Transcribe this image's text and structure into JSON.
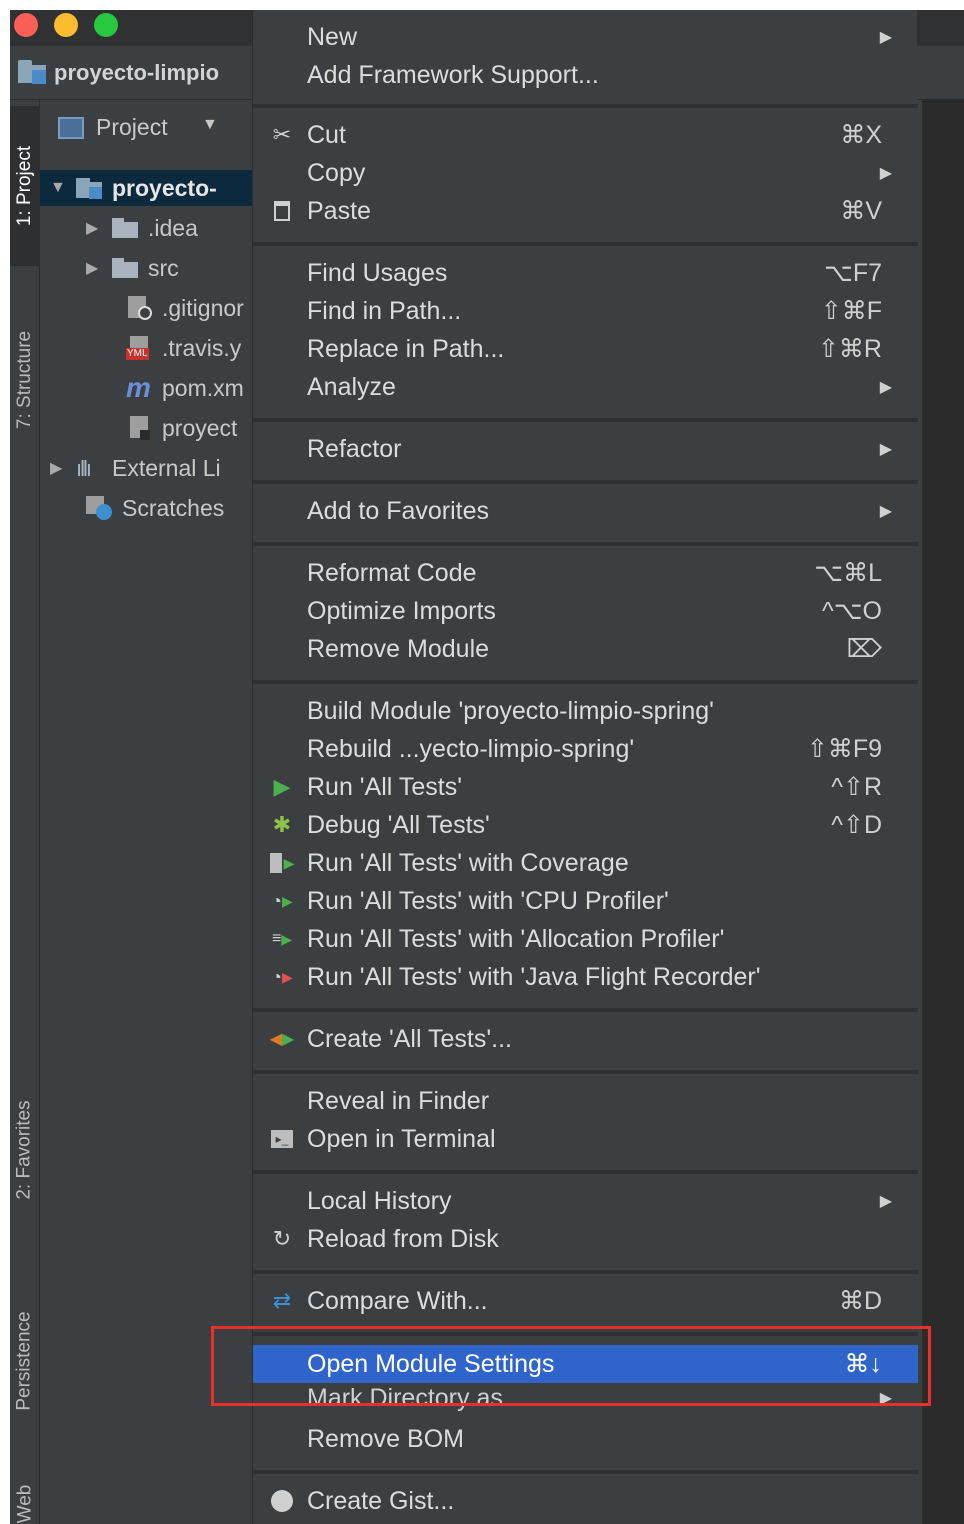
{
  "window": {
    "project_crumb": "proyecto-limpio"
  },
  "sidebar": {
    "tabs": [
      {
        "label": "1: Project"
      },
      {
        "label": "7: Structure"
      },
      {
        "label": "2: Favorites"
      },
      {
        "label": "Persistence"
      },
      {
        "label": "Web"
      }
    ]
  },
  "panel": {
    "header": "Project",
    "tree": [
      {
        "label": "proyecto-",
        "expanded": true
      },
      {
        "label": ".idea"
      },
      {
        "label": "src"
      },
      {
        "label": ".gitignor"
      },
      {
        "label": ".travis.y",
        "badge": "YML"
      },
      {
        "label": "pom.xm",
        "icon_glyph": "m"
      },
      {
        "label": "proyect"
      },
      {
        "label": "External Li"
      },
      {
        "label": "Scratches"
      }
    ]
  },
  "menu": {
    "items": [
      {
        "label": "New",
        "submenu": true
      },
      {
        "label": "Add Framework Support..."
      },
      {
        "label": "Cut",
        "shortcut": "⌘X",
        "icon": "scissors-icon"
      },
      {
        "label": "Copy",
        "submenu": true
      },
      {
        "label": "Paste",
        "shortcut": "⌘V",
        "icon": "clipboard-icon"
      },
      {
        "label": "Find Usages",
        "shortcut": "⌥F7"
      },
      {
        "label": "Find in Path...",
        "shortcut": "⇧⌘F"
      },
      {
        "label": "Replace in Path...",
        "shortcut": "⇧⌘R"
      },
      {
        "label": "Analyze",
        "submenu": true
      },
      {
        "label": "Refactor",
        "submenu": true
      },
      {
        "label": "Add to Favorites",
        "submenu": true
      },
      {
        "label": "Reformat Code",
        "shortcut": "⌥⌘L"
      },
      {
        "label": "Optimize Imports",
        "shortcut": "^⌥O"
      },
      {
        "label": "Remove Module",
        "shortcut": "⌦"
      },
      {
        "label": "Build Module 'proyecto-limpio-spring'"
      },
      {
        "label": "Rebuild ...yecto-limpio-spring'",
        "shortcut": "⇧⌘F9"
      },
      {
        "label": "Run 'All Tests'",
        "shortcut": "^⇧R",
        "icon": "run-icon"
      },
      {
        "label": "Debug 'All Tests'",
        "shortcut": "^⇧D",
        "icon": "debug-icon"
      },
      {
        "label": "Run 'All Tests' with Coverage",
        "icon": "coverage-icon"
      },
      {
        "label": "Run 'All Tests' with 'CPU Profiler'",
        "icon": "cpu-profiler-icon"
      },
      {
        "label": "Run 'All Tests' with 'Allocation Profiler'",
        "icon": "allocation-profiler-icon"
      },
      {
        "label": "Run 'All Tests' with 'Java Flight Recorder'",
        "icon": "flight-recorder-icon"
      },
      {
        "label": "Create 'All Tests'...",
        "icon": "create-config-icon"
      },
      {
        "label": "Reveal in Finder"
      },
      {
        "label": "Open in Terminal",
        "icon": "terminal-icon"
      },
      {
        "label": "Local History",
        "submenu": true
      },
      {
        "label": "Reload from Disk",
        "icon": "reload-icon"
      },
      {
        "label": "Compare With...",
        "shortcut": "⌘D",
        "icon": "compare-icon"
      },
      {
        "label": "Open Module Settings",
        "shortcut": "⌘↓",
        "highlighted": true
      },
      {
        "label": "Mark Directory as",
        "submenu": true
      },
      {
        "label": "Remove BOM"
      },
      {
        "label": "Create Gist...",
        "icon": "github-icon"
      }
    ]
  },
  "colors": {
    "highlight": "#2f65ca",
    "annotation_box": "#e8302a",
    "run_green": "#4caf50",
    "debug_green": "#8bc34a",
    "create_orange": "#e07b24"
  }
}
